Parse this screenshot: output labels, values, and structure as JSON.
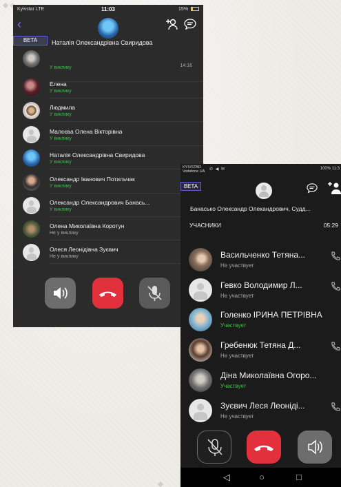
{
  "shot1": {
    "status": {
      "carrier": "Kyivstar  LTE",
      "time": "11:03",
      "battery": "15%"
    },
    "beta": "BETA",
    "group_title": "Наталія Олександрівна Свиридова",
    "rows": [
      {
        "name": "",
        "status": "У виклику",
        "time": "14:16",
        "active": true
      },
      {
        "name": "Елена",
        "status": "У виклику",
        "active": true
      },
      {
        "name": "Людмила",
        "status": "У виклику",
        "active": true
      },
      {
        "name": "Малєєва Олена Вікторівна",
        "status": "У виклику",
        "active": true
      },
      {
        "name": "Наталія Олександрівна Свиридова",
        "status": "У виклику",
        "active": true
      },
      {
        "name": "Олександр Іванович Потильчак",
        "status": "У виклику",
        "active": true
      },
      {
        "name": "Олександр Олександрович Банась...",
        "status": "У виклику",
        "active": true
      },
      {
        "name": "Олена Миколаївна  Коротун",
        "status": "Не у виклику",
        "active": false
      },
      {
        "name": "Олеся Леонідівна Зуєвич",
        "status": "Не у виклику",
        "active": false
      }
    ]
  },
  "shot2": {
    "status": {
      "carrier_line1": "KYIVSTAR",
      "carrier_line2": "Vodafone UA",
      "right": "100%  11:3"
    },
    "beta": "BETA",
    "group_title": "Банасько Олександр Олекандрович, Судд...",
    "section_label": "УЧАСНИКИ",
    "duration": "05:29",
    "rows": [
      {
        "name": "Васильченко Тетяна...",
        "status": "Не участвует",
        "active": false,
        "call_icon": true
      },
      {
        "name": "Гевко Володимир Л...",
        "status": "Не участвует",
        "active": false,
        "call_icon": true
      },
      {
        "name": "Голенко ІРИНА ПЕТРІВНА",
        "status": "Участвует",
        "active": true,
        "call_icon": false
      },
      {
        "name": "Гребенюк Тетяна Д...",
        "status": "Не участвует",
        "active": false,
        "call_icon": true
      },
      {
        "name": "Діна Миколаївна Огоро...",
        "status": "Участвует",
        "active": true,
        "call_icon": false
      },
      {
        "name": "Зуєвич Леся Леоніді...",
        "status": "Не участвует",
        "active": false,
        "call_icon": true
      }
    ]
  },
  "colors": {
    "accent": "#7b6ff3",
    "end_call": "#e2313d",
    "in_call": "#3fbf4c"
  }
}
